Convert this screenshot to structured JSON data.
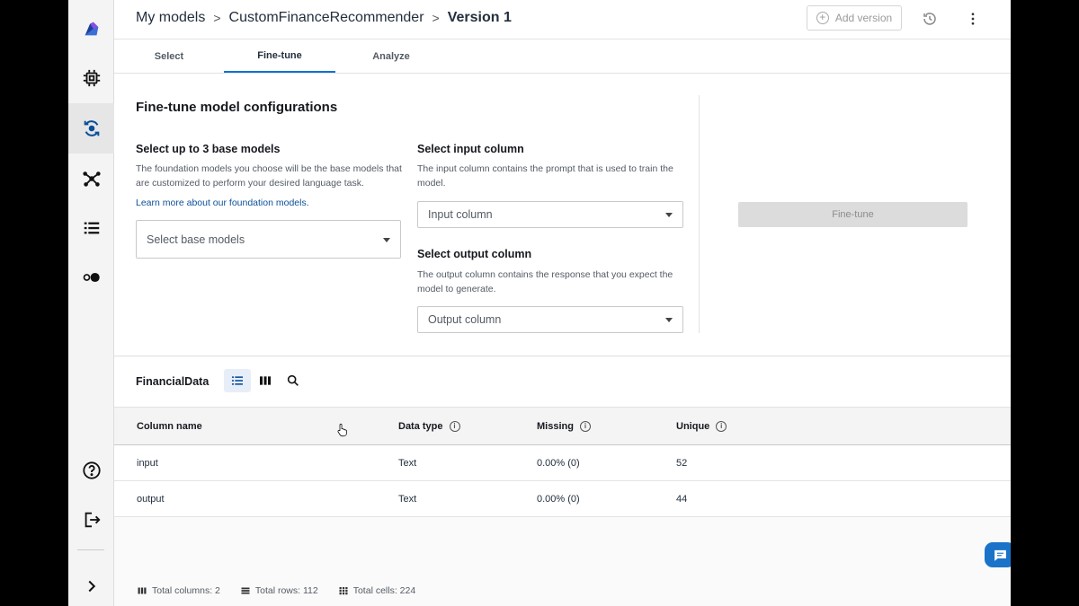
{
  "breadcrumb": {
    "items": [
      "My models",
      "CustomFinanceRecommender",
      "Version 1"
    ]
  },
  "header": {
    "add_version_label": "Add version"
  },
  "tabs": [
    {
      "label": "Select",
      "active": false
    },
    {
      "label": "Fine-tune",
      "active": true
    },
    {
      "label": "Analyze",
      "active": false
    }
  ],
  "config": {
    "title": "Fine-tune model configurations",
    "base_models": {
      "title": "Select up to 3 base models",
      "description": "The foundation models you choose will be the base models that are customized to perform your desired language task.",
      "link": "Learn more about our foundation models.",
      "placeholder": "Select base models"
    },
    "input_column": {
      "title": "Select input column",
      "description": "The input column contains the prompt that is used to train the model.",
      "placeholder": "Input column"
    },
    "output_column": {
      "title": "Select output column",
      "description": "The output column contains the response that you expect the model to generate.",
      "placeholder": "Output column"
    },
    "finetune_label": "Fine-tune"
  },
  "dataset": {
    "name": "FinancialData",
    "columns": [
      "Column name",
      "Data type",
      "Missing",
      "Unique"
    ],
    "rows": [
      {
        "name": "input",
        "type": "Text",
        "missing": "0.00% (0)",
        "unique": "52"
      },
      {
        "name": "output",
        "type": "Text",
        "missing": "0.00% (0)",
        "unique": "44"
      }
    ],
    "stats": {
      "columns": "Total columns: 2",
      "rows": "Total rows: 112",
      "cells": "Total cells: 224"
    }
  },
  "icons": [
    "logo-icon",
    "chip-icon",
    "refresh-icon",
    "network-icon",
    "list-icon",
    "toggle-icon",
    "help-icon",
    "sign-out-icon",
    "expand-icon",
    "history-icon",
    "more-icon",
    "list-view-icon",
    "column-view-icon",
    "search-icon",
    "chat-icon"
  ],
  "colors": {
    "accent": "#0972d3",
    "chat": "#1a73c8"
  }
}
